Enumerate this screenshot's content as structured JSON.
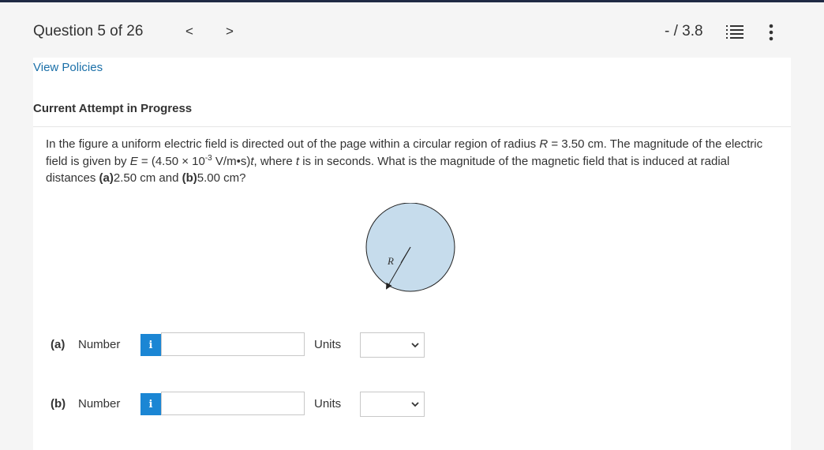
{
  "header": {
    "question_label": "Question 5 of 26",
    "prev_glyph": "<",
    "next_glyph": ">",
    "score": "- / 3.8"
  },
  "content": {
    "view_policies": "View Policies",
    "attempt_heading": "Current Attempt in Progress",
    "problem": {
      "p1": "In the figure a uniform electric field is directed out of the page within a circular region of radius ",
      "r_sym": "R",
      "p2": " = 3.50 cm. The magnitude of the electric field is given by ",
      "e_sym": "E",
      "p3": " = (4.50 × 10",
      "exp": "-3",
      "p4": " V/m•s)",
      "t_sym": "t",
      "p5": ", where ",
      "t_sym2": "t",
      "p6": " is in seconds. What is the magnitude of the magnetic field that is induced at radial distances ",
      "a_lbl": "(a)",
      "a_val": "2.50 cm and ",
      "b_lbl": "(b)",
      "b_val": "5.00 cm?"
    },
    "figure": {
      "radius_label": "R",
      "fill_color": "#c6dcec"
    },
    "answers": [
      {
        "label": "(a)",
        "type_label": "Number",
        "info_glyph": "i",
        "value": "",
        "units_label": "Units",
        "unit_selected": ""
      },
      {
        "label": "(b)",
        "type_label": "Number",
        "info_glyph": "i",
        "value": "",
        "units_label": "Units",
        "unit_selected": ""
      }
    ]
  },
  "colors": {
    "link": "#1a6fa8",
    "info_button": "#1b86d4",
    "top_bar": "#1f2a44"
  }
}
